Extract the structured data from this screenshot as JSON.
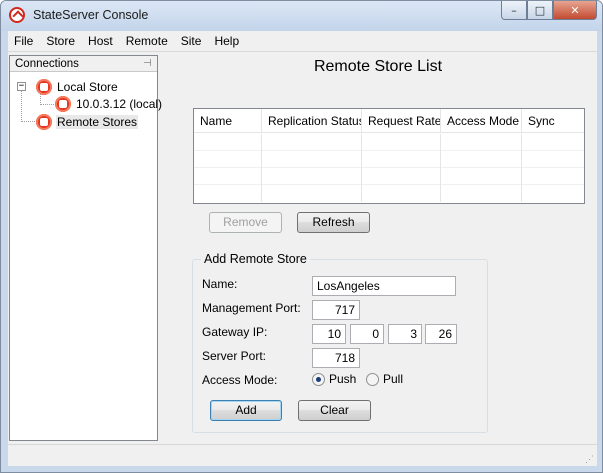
{
  "window": {
    "title": "StateServer Console",
    "controls": {
      "minimize": "–",
      "maximize": "□",
      "close": "✕"
    }
  },
  "menu": [
    "File",
    "Store",
    "Host",
    "Remote",
    "Site",
    "Help"
  ],
  "connections": {
    "header": "Connections",
    "tree": {
      "local_store": "Local Store",
      "local_host": "10.0.3.12 (local)",
      "remote_stores": "Remote Stores"
    }
  },
  "main": {
    "title": "Remote Store List",
    "columns": [
      "Name",
      "Replication Status",
      "Request Rate",
      "Access Mode",
      "Sync"
    ],
    "rows": [],
    "buttons": {
      "remove": "Remove",
      "refresh": "Refresh"
    }
  },
  "add_remote_store": {
    "title": "Add Remote Store",
    "name_label": "Name:",
    "name_value": "LosAngeles",
    "management_port_label": "Management Port:",
    "management_port_value": "717",
    "gateway_ip_label": "Gateway IP:",
    "gateway_ip": [
      "10",
      "0",
      "3",
      "26"
    ],
    "server_port_label": "Server Port:",
    "server_port_value": "718",
    "access_mode_label": "Access Mode:",
    "access_mode_options": [
      "Push",
      "Pull"
    ],
    "access_mode_selected": "Push",
    "buttons": {
      "add": "Add",
      "clear": "Clear"
    }
  }
}
